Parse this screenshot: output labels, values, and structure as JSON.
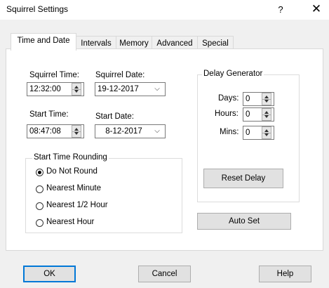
{
  "window": {
    "title": "Squirrel Settings",
    "help_label": "?",
    "close_label": "✕"
  },
  "tabs": [
    {
      "label": "Time and Date",
      "active": true
    },
    {
      "label": "Intervals"
    },
    {
      "label": "Memory"
    },
    {
      "label": "Advanced"
    },
    {
      "label": "Special"
    }
  ],
  "time_date": {
    "squirrel_time_label": "Squirrel Time:",
    "squirrel_time_value": "12:32:00",
    "squirrel_date_label": "Squirrel Date:",
    "squirrel_date_value": "19-12-2017",
    "start_time_label": "Start Time:",
    "start_time_value": "08:47:08",
    "start_date_label": "Start Date:",
    "start_date_value": "8-12-2017"
  },
  "rounding": {
    "title": "Start Time Rounding",
    "options": [
      {
        "label": "Do Not Round",
        "selected": true
      },
      {
        "label": "Nearest Minute",
        "selected": false
      },
      {
        "label": "Nearest 1/2 Hour",
        "selected": false
      },
      {
        "label": "Nearest Hour",
        "selected": false
      }
    ]
  },
  "delay": {
    "title": "Delay Generator",
    "days_label": "Days:",
    "days_value": "0",
    "hours_label": "Hours:",
    "hours_value": "0",
    "mins_label": "Mins:",
    "mins_value": "0",
    "reset_label": "Reset Delay"
  },
  "auto_set_label": "Auto Set",
  "footer": {
    "ok_label": "OK",
    "cancel_label": "Cancel",
    "help_label": "Help"
  },
  "icons": {
    "spin": "spin-updown-icon",
    "dropdown": "chevron-down-icon",
    "radio": "radio-icon"
  },
  "colors": {
    "focus_border": "#0078d7",
    "window_bg": "#f0f0f0",
    "panel_bg": "#ffffff"
  }
}
